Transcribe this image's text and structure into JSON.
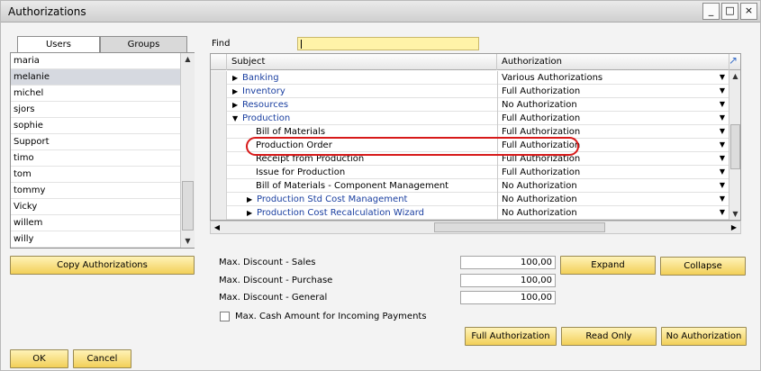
{
  "window": {
    "title": "Authorizations",
    "controls": {
      "minimize": "_",
      "maximize": "□",
      "close": "×"
    }
  },
  "tabs": [
    {
      "label": "Users"
    },
    {
      "label": "Groups"
    }
  ],
  "users": [
    "maria",
    "melanie",
    "michel",
    "sjors",
    "sophie",
    "Support",
    "timo",
    "tom",
    "tommy",
    "Vicky",
    "willem",
    "willy"
  ],
  "selected_user": "melanie",
  "copy_button": "Copy Authorizations",
  "find": {
    "label": "Find",
    "value": ""
  },
  "grid": {
    "headers": {
      "subject": "Subject",
      "authorization": "Authorization"
    },
    "rows": [
      {
        "subject": "Banking",
        "authorization": "Various Authorizations",
        "level": 0,
        "expandable": true,
        "expanded": false
      },
      {
        "subject": "Inventory",
        "authorization": "Full Authorization",
        "level": 0,
        "expandable": true,
        "expanded": false
      },
      {
        "subject": "Resources",
        "authorization": "No Authorization",
        "level": 0,
        "expandable": true,
        "expanded": false
      },
      {
        "subject": "Production",
        "authorization": "Full Authorization",
        "level": 0,
        "expandable": true,
        "expanded": true
      },
      {
        "subject": "Bill of Materials",
        "authorization": "Full Authorization",
        "level": 1,
        "expandable": false
      },
      {
        "subject": "Production Order",
        "authorization": "Full Authorization",
        "level": 1,
        "expandable": false,
        "highlighted": true
      },
      {
        "subject": "Receipt from Production",
        "authorization": "Full Authorization",
        "level": 1,
        "expandable": false
      },
      {
        "subject": "Issue for Production",
        "authorization": "Full Authorization",
        "level": 1,
        "expandable": false
      },
      {
        "subject": "Bill of Materials - Component Management",
        "authorization": "No Authorization",
        "level": 1,
        "expandable": false
      },
      {
        "subject": "Production Std Cost Management",
        "authorization": "No Authorization",
        "level": 1,
        "expandable": true,
        "expanded": false
      },
      {
        "subject": "Production Cost Recalculation Wizard",
        "authorization": "No Authorization",
        "level": 1,
        "expandable": true,
        "expanded": false
      }
    ]
  },
  "discounts": [
    {
      "label": "Max. Discount - Sales",
      "value": "100,00"
    },
    {
      "label": "Max. Discount - Purchase",
      "value": "100,00"
    },
    {
      "label": "Max. Discount - General",
      "value": "100,00"
    }
  ],
  "cash_checkbox": {
    "label": "Max. Cash Amount for Incoming Payments",
    "checked": false
  },
  "buttons": {
    "expand": "Expand",
    "collapse": "Collapse",
    "full": "Full Authorization",
    "read_only": "Read Only",
    "none": "No Authorization",
    "ok": "OK",
    "cancel": "Cancel"
  },
  "colors": {
    "highlight_ring": "#d71a1a",
    "button_gold": "#f2cf58",
    "link_blue": "#1a3fa0",
    "find_yellow": "#fff3a8"
  },
  "icons": {
    "expand_arrow": "▶",
    "collapse_arrow": "▼",
    "dropdown": "▼"
  }
}
